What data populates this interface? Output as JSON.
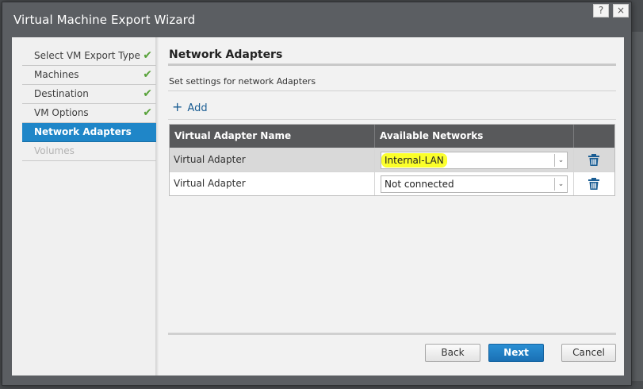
{
  "window": {
    "title": "Virtual Machine Export Wizard",
    "help_label": "?",
    "close_label": "×"
  },
  "steps": [
    {
      "label": "Select VM Export Type",
      "state": "complete"
    },
    {
      "label": "Machines",
      "state": "complete"
    },
    {
      "label": "Destination",
      "state": "complete"
    },
    {
      "label": "VM Options",
      "state": "complete"
    },
    {
      "label": "Network Adapters",
      "state": "active"
    },
    {
      "label": "Volumes",
      "state": "disabled"
    }
  ],
  "check_glyph": "✔",
  "section": {
    "title": "Network Adapters",
    "subtitle": "Set settings for network Adapters",
    "add_label": "Add",
    "add_glyph": "+"
  },
  "grid": {
    "columns": [
      "Virtual Adapter Name",
      "Available Networks",
      ""
    ],
    "rows": [
      {
        "name": "Virtual Adapter",
        "network": "Internal-LAN",
        "highlighted": true
      },
      {
        "name": "Virtual Adapter",
        "network": "Not connected",
        "highlighted": false
      }
    ]
  },
  "footer": {
    "back_label": "Back",
    "next_label": "Next",
    "cancel_label": "Cancel"
  },
  "colors": {
    "accent": "#1f86c8",
    "check": "#58a23a",
    "highlight": "#fbff2a",
    "header": "#58595b"
  }
}
